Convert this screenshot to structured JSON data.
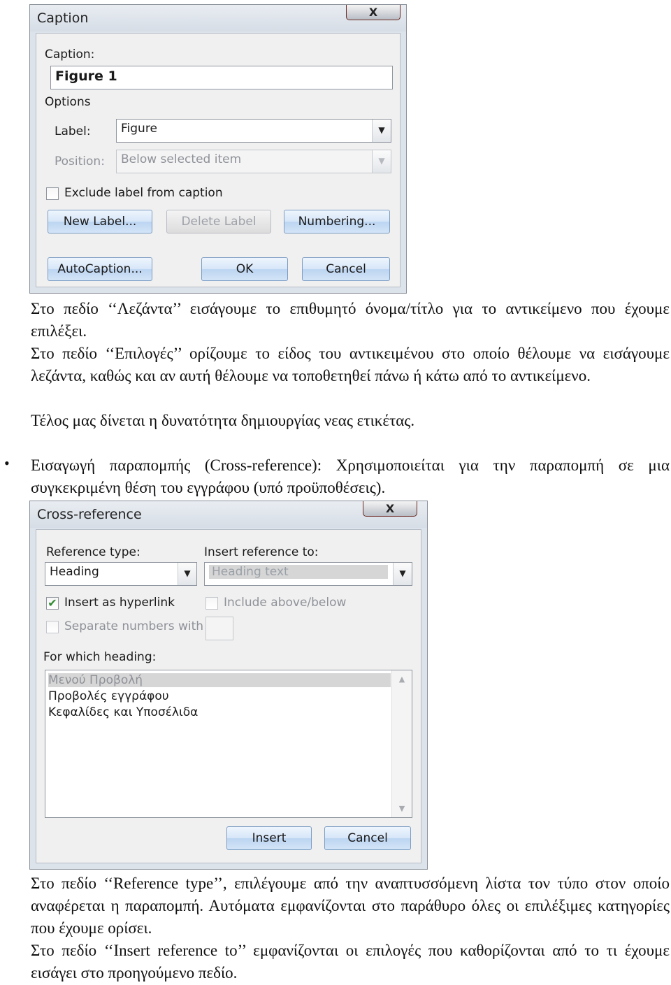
{
  "caption_dialog": {
    "title": "Caption",
    "close_label": "X",
    "caption_label": "Caption:",
    "caption_value": "Figure 1",
    "options_label": "Options",
    "label_label": "Label:",
    "label_value": "Figure",
    "position_label": "Position:",
    "position_value": "Below selected item",
    "exclude_label": "Exclude label from caption",
    "exclude_checked": false,
    "new_label_button": "New Label...",
    "delete_label_button": "Delete Label",
    "numbering_button": "Numbering...",
    "autocaption_button": "AutoCaption...",
    "ok_button": "OK",
    "cancel_button": "Cancel"
  },
  "text_block_1": {
    "p1": "Στο πεδίο ‘‘Λεζάντα’’ εισάγουμε το επιθυμητό όνομα/τίτλο για το αντικείμενο που έχουμε επιλέξει.",
    "p2": "Στο πεδίο ‘‘Επιλογές’’ ορίζουμε το είδος του αντικειμένου στο οποίο θέλουμε να εισάγουμε λεζάντα, καθώς και αν αυτή θέλουμε να τοποθετηθεί πάνω ή κάτω από το αντικείμενο.",
    "p3": "Τέλος μας δίνεται η δυνατότητα δημιουργίας νεας ετικέτας."
  },
  "bullet": {
    "symbol": "•",
    "text": "Εισαγωγή παραπομπής (Cross-reference): Χρησιμοποιείται για την παραπομπή σε μια συγκεκριμένη θέση του εγγράφου (υπό προϋποθέσεις)."
  },
  "crossref_dialog": {
    "title": "Cross-reference",
    "close_label": "X",
    "reference_type_label": "Reference type:",
    "reference_type_value": "Heading",
    "insert_reference_label": "Insert reference to:",
    "insert_reference_value": "Heading text",
    "insert_hyperlink_label": "Insert as hyperlink",
    "insert_hyperlink_checked": true,
    "include_above_label": "Include above/below",
    "separate_numbers_label": "Separate numbers with",
    "for_which_label": "For which heading:",
    "headings": [
      "Μενού Προβολή",
      "Προβολές εγγράφου",
      "Κεφαλίδες και Υποσέλιδα"
    ],
    "insert_button": "Insert",
    "cancel_button": "Cancel"
  },
  "text_block_2": {
    "p1": "Στο πεδίο ‘‘Reference type’’, επιλέγουμε από την αναπτυσσόμενη λίστα τον τύπο στον οποίο αναφέρεται η παραπομπή. Αυτόματα εμφανίζονται στο παράθυρο όλες οι επιλέξιμες κατηγορίες που έχουμε ορίσει.",
    "p2": "Στο πεδίο ‘‘Insert reference to’’ εμφανίζονται οι επιλογές που καθορίζονται από το τι έχουμε εισάγει στο προηγούμενο πεδίο."
  }
}
